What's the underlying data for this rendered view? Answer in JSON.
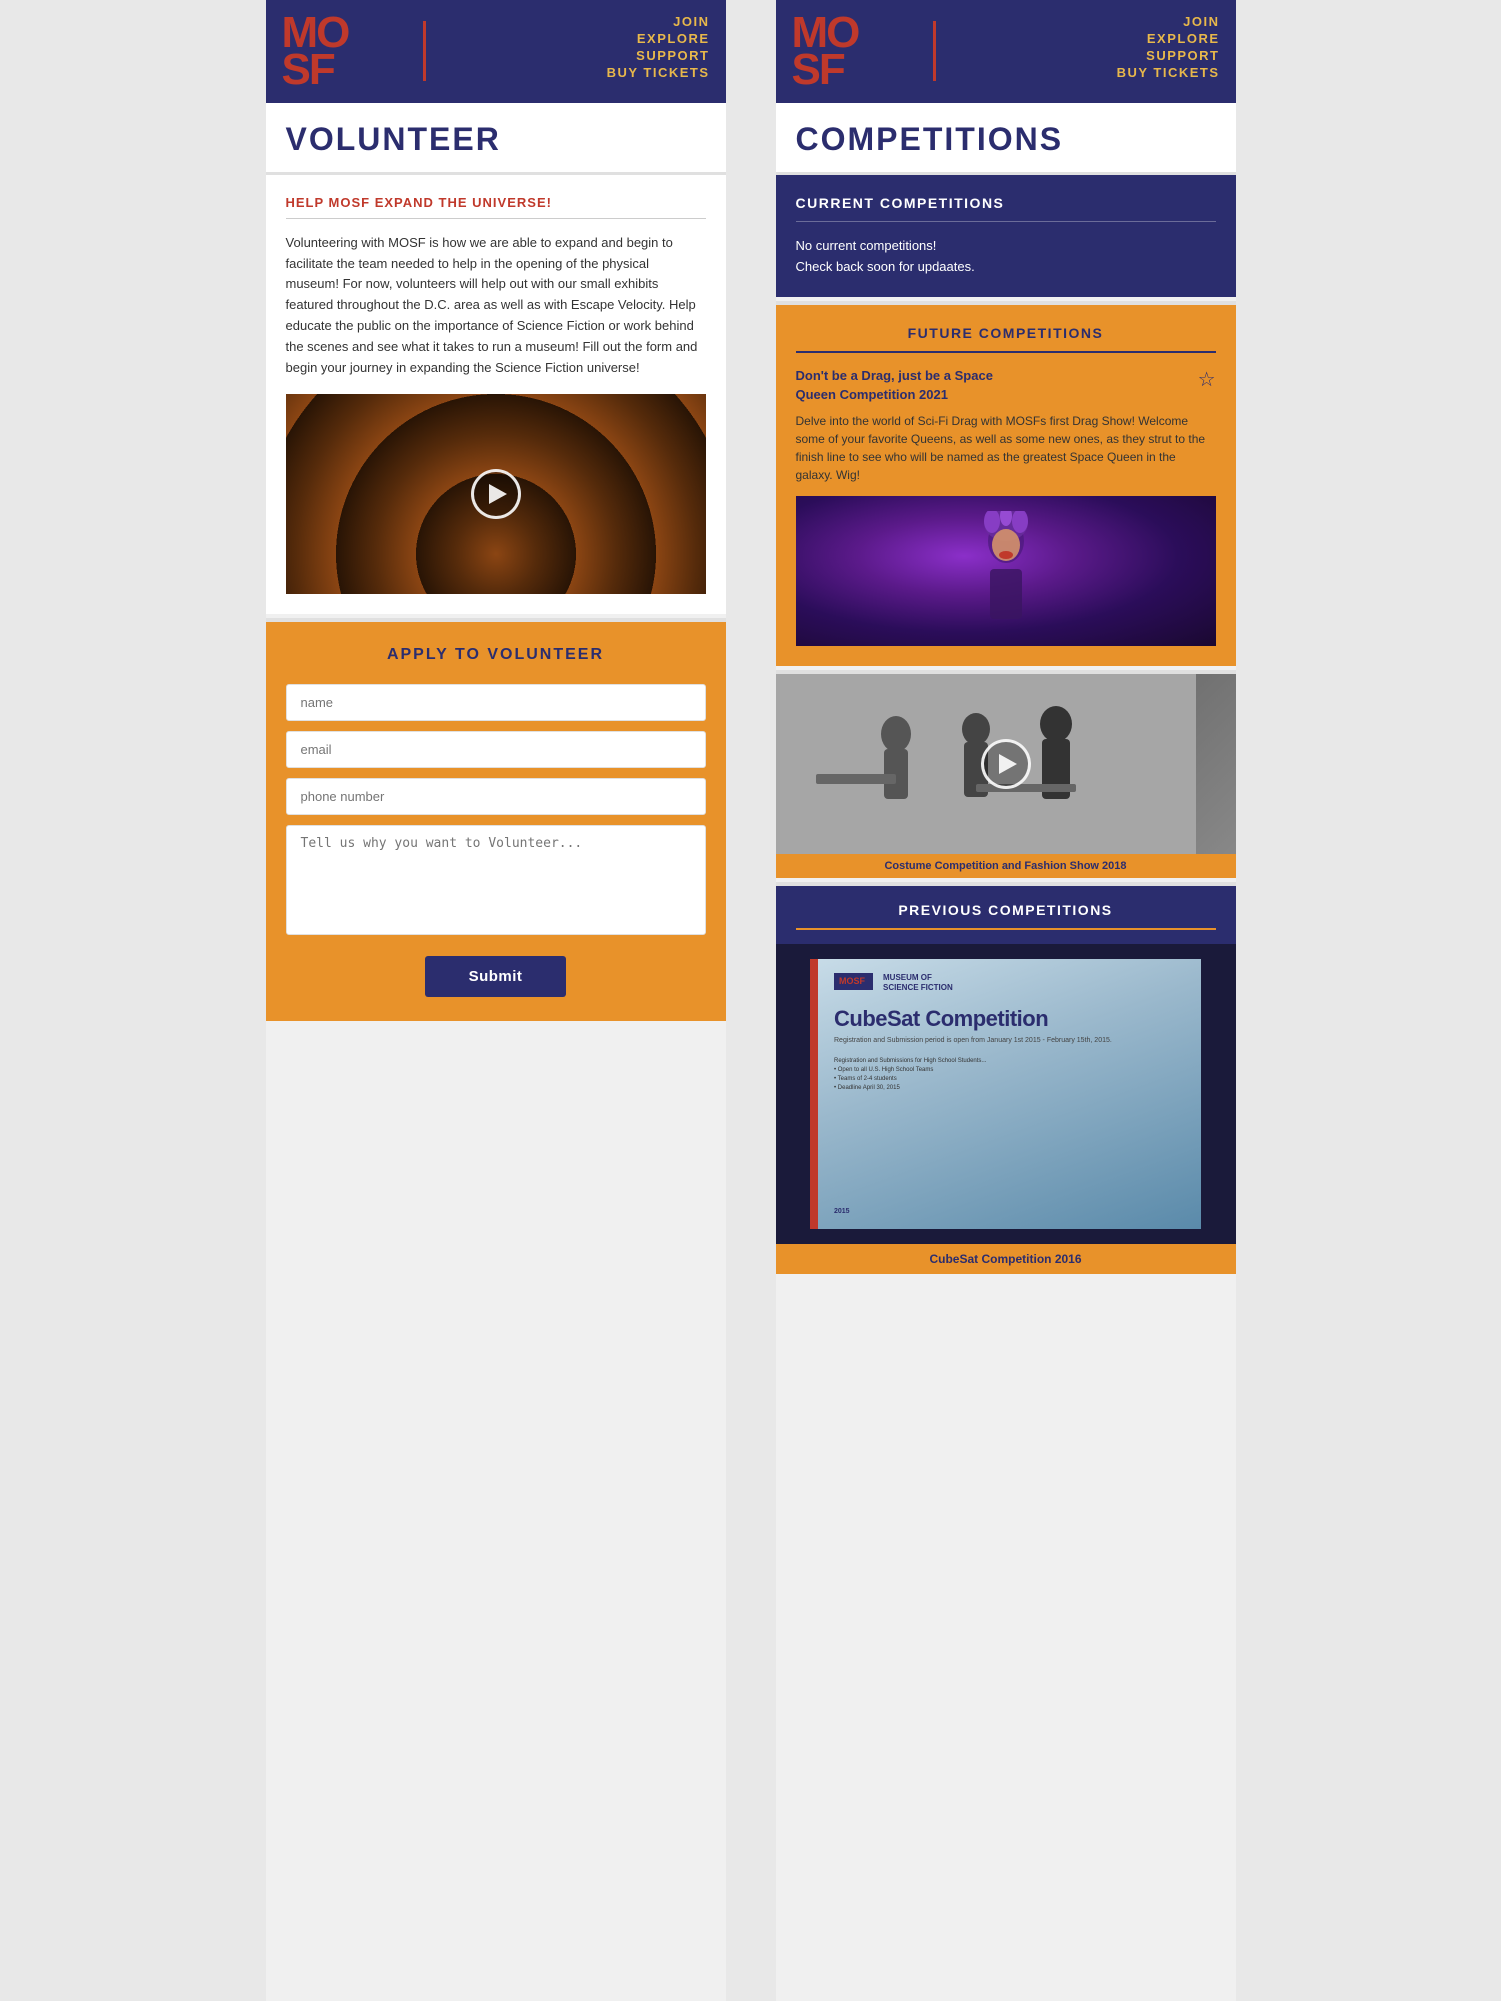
{
  "left": {
    "header": {
      "logo_mo": "MO",
      "logo_sf": "SF",
      "nav": {
        "join": "JOIN",
        "explore": "EXPLORE",
        "support": "SUPPORT",
        "buy_tickets": "BUY TICKETS"
      }
    },
    "page_title": "VOLUNTEER",
    "section_heading": "HELP MOSF EXPAND THE UNIVERSE!",
    "body_text": "Volunteering with MOSF is how we are able to expand and begin to facilitate the team needed to help in the opening of the physical museum! For now, volunteers will help out with our small exhibits featured throughout the D.C. area as well as with Escape Velocity. Help educate the public on the importance of Science Fiction or work behind the scenes and see what it takes to run a museum! Fill out the form and begin your journey in expanding the Science Fiction universe!",
    "apply_title": "APPLY TO VOLUNTEER",
    "form": {
      "name_placeholder": "name",
      "email_placeholder": "email",
      "phone_placeholder": "phone number",
      "message_placeholder": "Tell us why you want to Volunteer...",
      "submit_label": "Submit"
    }
  },
  "right": {
    "header": {
      "logo_mo": "MO",
      "logo_sf": "SF",
      "nav": {
        "join": "JOIN",
        "explore": "EXPLORE",
        "support": "SUPPORT",
        "buy_tickets": "BUY TICKETS"
      }
    },
    "page_title": "COMPETITIONS",
    "current": {
      "heading": "CURRENT COMPETITIONS",
      "no_competitions": "No current competitions!",
      "check_back": "Check back soon for updaates."
    },
    "future": {
      "heading": "FUTURE COMPETITIONS",
      "card1": {
        "title": "Don't be a Drag, just be a Space Queen Competition 2021",
        "description": "Delve into the world of Sci-Fi Drag with MOSFs first Drag Show! Welcome some of your favorite Queens, as well as some new ones, as they strut to the finish line to see who will be named as the greatest Space Queen in the galaxy. Wig!"
      },
      "card2": {
        "caption": "Costume Competition and Fashion Show 2018"
      }
    },
    "previous": {
      "heading": "PREVIOUS COMPETITIONS",
      "card1": {
        "title": "CubeSat Competition",
        "subtitle": "MUSEUM OF SCIENCE FICTION",
        "body": "Registration and Submission period is open from January 1st 2015 - February 15th, 2015.",
        "caption": "CubeSat Competition 2016",
        "year": "2015"
      }
    }
  }
}
